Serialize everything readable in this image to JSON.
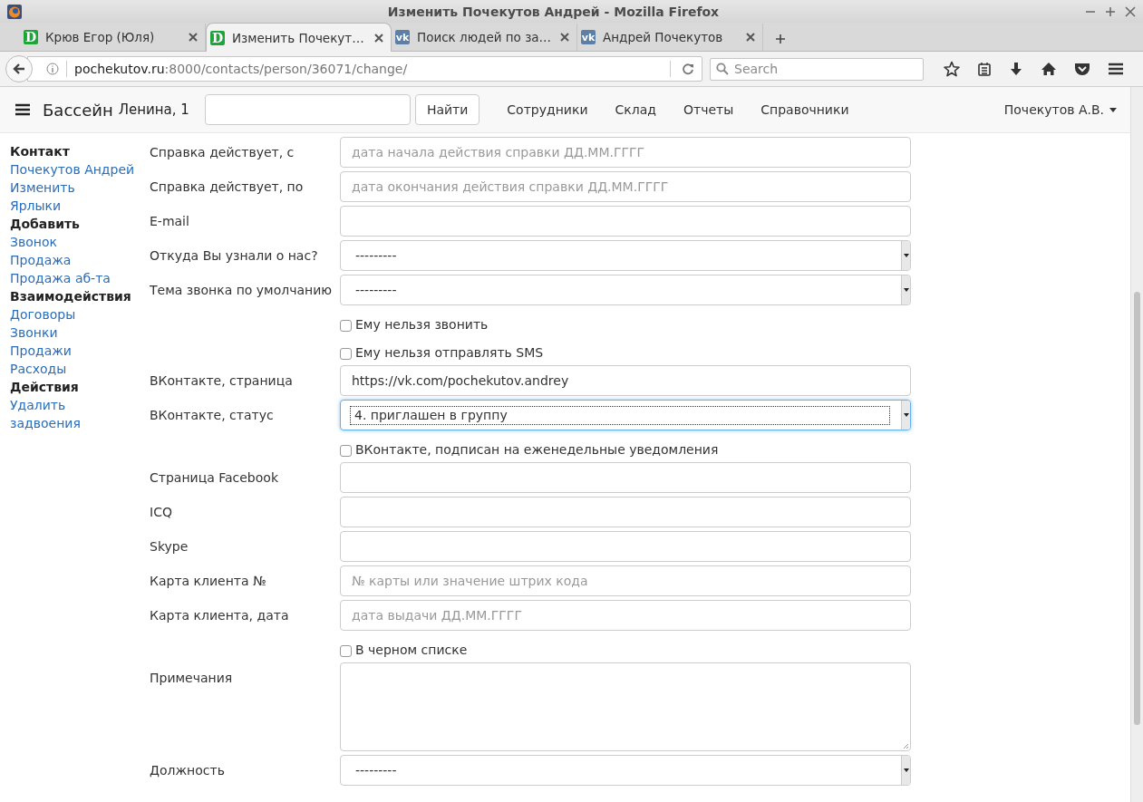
{
  "window": {
    "title": "Изменить Почекутов Андрей - Mozilla Firefox"
  },
  "tabs": [
    {
      "label": "Крюв Егор (Юля)",
      "favicon": "D",
      "color": "#1ea53a",
      "selected": false
    },
    {
      "label": "Изменить Почекут…",
      "favicon": "D",
      "color": "#1ea53a",
      "selected": true
    },
    {
      "label": "Поиск людей по за…",
      "favicon": "vk",
      "color": "#5b7fa6",
      "selected": false
    },
    {
      "label": "Андрей Почекутов",
      "favicon": "vk",
      "color": "#5b7fa6",
      "selected": false
    }
  ],
  "address": {
    "host": "pochekutov.ru",
    "path": ":8000/contacts/person/36071/change/"
  },
  "search": {
    "placeholder": "Search"
  },
  "navbar": {
    "brand": "Бассейн",
    "location": "Ленина, 1",
    "search_button": "Найти",
    "links": [
      "Сотрудники",
      "Склад",
      "Отчеты",
      "Справочники"
    ],
    "user": "Почекутов А.В."
  },
  "sidebar": [
    {
      "text": "Контакт",
      "kind": "heading"
    },
    {
      "text": "Почекутов Андрей",
      "kind": "link"
    },
    {
      "text": "Изменить",
      "kind": "link"
    },
    {
      "text": "Ярлыки",
      "kind": "link"
    },
    {
      "text": "Добавить",
      "kind": "heading"
    },
    {
      "text": "Звонок",
      "kind": "link"
    },
    {
      "text": "Продажа",
      "kind": "link"
    },
    {
      "text": "Продажа аб-та",
      "kind": "link"
    },
    {
      "text": "Взаимодействия",
      "kind": "heading"
    },
    {
      "text": "Договоры",
      "kind": "link"
    },
    {
      "text": "Звонки",
      "kind": "link"
    },
    {
      "text": "Продажи",
      "kind": "link"
    },
    {
      "text": "Расходы",
      "kind": "link"
    },
    {
      "text": "Действия",
      "kind": "heading"
    },
    {
      "text": "Удалить",
      "kind": "link"
    },
    {
      "text": "задвоения",
      "kind": "link"
    }
  ],
  "form": [
    {
      "kind": "text",
      "label": "Справка действует, с",
      "placeholder": "дата начала действия справки ДД.ММ.ГГГГ"
    },
    {
      "kind": "text",
      "label": "Справка действует, по",
      "placeholder": "дата окончания действия справки ДД.ММ.ГГГГ"
    },
    {
      "kind": "text",
      "label": "E-mail"
    },
    {
      "kind": "select",
      "label": "Откуда Вы узнали о нас?",
      "value": "---------",
      "focused": false
    },
    {
      "kind": "select",
      "label": "Тема звонка по умолчанию",
      "value": "---------",
      "focused": false
    },
    {
      "kind": "checkbox",
      "label": "Ему нельзя звонить",
      "checked": false
    },
    {
      "kind": "checkbox",
      "label": "Ему нельзя отправлять SMS",
      "checked": false
    },
    {
      "kind": "text",
      "label": "ВКонтакте, страница",
      "value": "https://vk.com/pochekutov.andrey"
    },
    {
      "kind": "select",
      "label": "ВКонтакте, статус",
      "value": "4. приглашен в группу",
      "focused": true
    },
    {
      "kind": "checkbox",
      "label": "ВКонтакте, подписан на еженедельные уведомления",
      "checked": false
    },
    {
      "kind": "text",
      "label": "Страница Facebook"
    },
    {
      "kind": "text",
      "label": "ICQ"
    },
    {
      "kind": "text",
      "label": "Skype"
    },
    {
      "kind": "text",
      "label": "Карта клиента №",
      "placeholder": "№ карты или значение штрих кода"
    },
    {
      "kind": "text",
      "label": "Карта клиента, дата",
      "placeholder": "дата выдачи ДД.ММ.ГГГГ"
    },
    {
      "kind": "checkbox",
      "label": "В черном списке",
      "checked": false
    },
    {
      "kind": "textarea",
      "label": "Примечания"
    },
    {
      "kind": "select",
      "label": "Должность",
      "value": "---------",
      "focused": false
    }
  ]
}
